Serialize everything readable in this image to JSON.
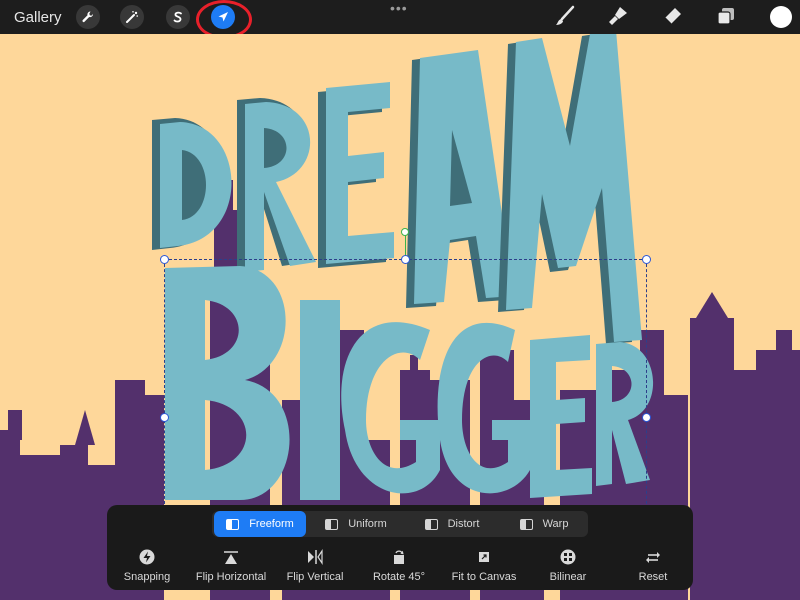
{
  "topbar": {
    "gallery_label": "Gallery",
    "left_tools": [
      {
        "name": "actions",
        "icon": "wrench-icon"
      },
      {
        "name": "adjustments",
        "icon": "magic-wand-icon"
      },
      {
        "name": "selection",
        "icon": "selection-s-icon"
      },
      {
        "name": "transform",
        "icon": "arrow-cursor-icon",
        "active": true
      }
    ],
    "more_label": "•••",
    "right_tools": [
      {
        "name": "brush",
        "icon": "brush-icon"
      },
      {
        "name": "smudge",
        "icon": "smudge-icon"
      },
      {
        "name": "eraser",
        "icon": "eraser-icon"
      },
      {
        "name": "layers",
        "icon": "layers-icon"
      }
    ],
    "current_color": "#ffffff"
  },
  "artwork": {
    "line1": "DREAM",
    "line2": "BIGGER",
    "background_color": "#fed79a",
    "letter_color": "#77bac8",
    "letter_shadow_color": "#3f6e78",
    "skyline_color": "#53306c"
  },
  "transform_panel": {
    "modes": [
      {
        "label": "Freeform",
        "active": true
      },
      {
        "label": "Uniform",
        "active": false
      },
      {
        "label": "Distort",
        "active": false
      },
      {
        "label": "Warp",
        "active": false
      }
    ],
    "actions": [
      {
        "label": "Snapping",
        "icon": "lightning-icon"
      },
      {
        "label": "Flip Horizontal",
        "icon": "flip-horizontal-icon"
      },
      {
        "label": "Flip Vertical",
        "icon": "flip-vertical-icon"
      },
      {
        "label": "Rotate 45°",
        "icon": "rotate-icon"
      },
      {
        "label": "Fit to Canvas",
        "icon": "fit-canvas-icon"
      },
      {
        "label": "Bilinear",
        "icon": "bilinear-icon"
      },
      {
        "label": "Reset",
        "icon": "reset-icon"
      }
    ],
    "active_color": "#1e7cf5"
  },
  "annotation": {
    "highlight_color": "#e8202a"
  }
}
